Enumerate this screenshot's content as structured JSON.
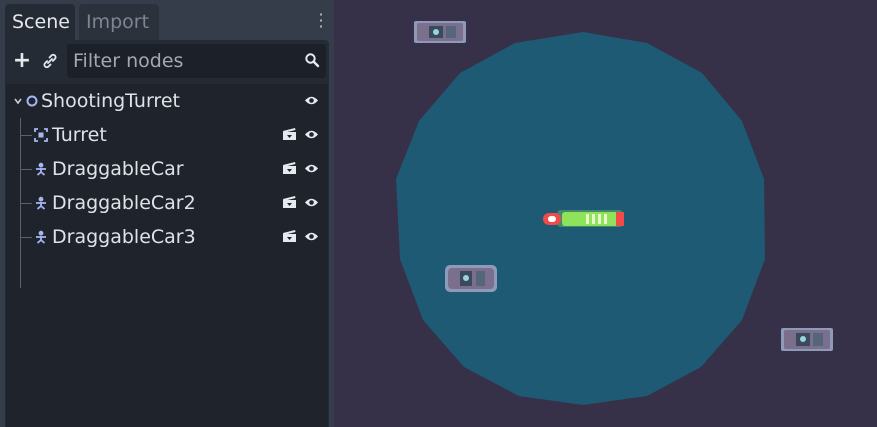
{
  "tabs": {
    "scene": "Scene",
    "import": "Import"
  },
  "toolbar": {
    "add": "+",
    "filter_placeholder": "Filter nodes"
  },
  "tree": {
    "root": {
      "label": "ShootingTurret",
      "icon": "node2d-icon"
    },
    "children": [
      {
        "label": "Turret",
        "icon": "area2d-icon"
      },
      {
        "label": "DraggableCar",
        "icon": "kinematic-body-icon"
      },
      {
        "label": "DraggableCar2",
        "icon": "kinematic-body-icon"
      },
      {
        "label": "DraggableCar3",
        "icon": "kinematic-body-icon"
      }
    ]
  },
  "colors": {
    "panel": "#252b34",
    "tree_bg": "#1f242c",
    "viewport_bg": "#363149",
    "range_circle": "#1e5a74",
    "node_icon": "#a5b6f3",
    "turret_body": "#8ee35a",
    "turret_red": "#f24a4a",
    "car_body": "#7a6f8c"
  }
}
